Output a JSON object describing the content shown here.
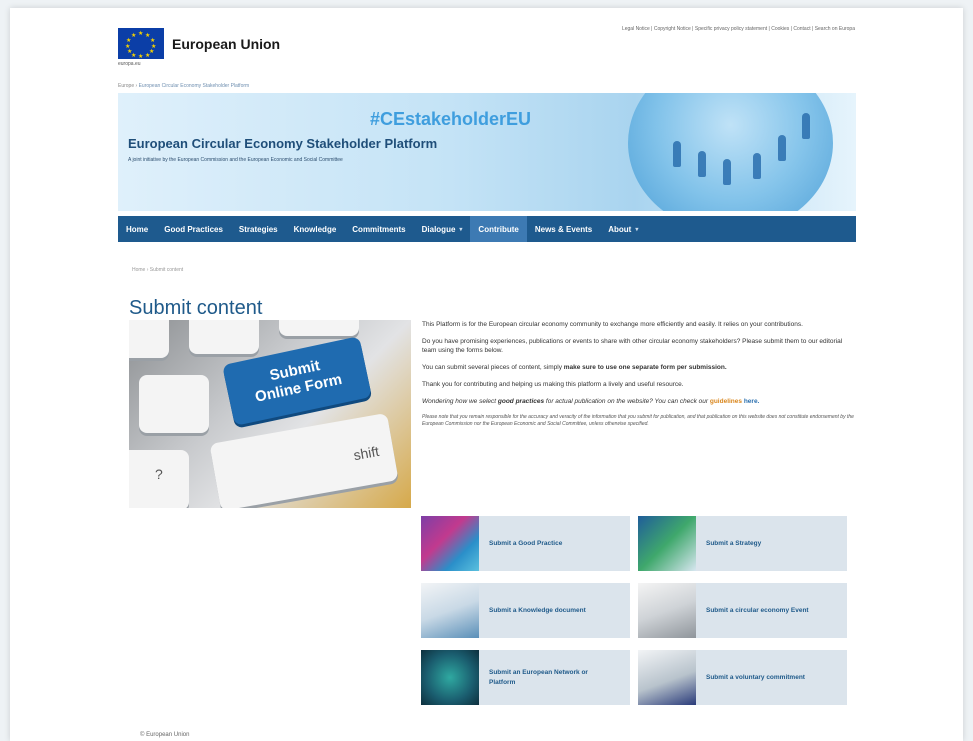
{
  "header": {
    "eu_title": "European Union",
    "eu_subtitle": "europa.eu",
    "top_links": [
      "Legal Notice",
      "Copyright Notice",
      "Specific privacy policy statement",
      "Cookies",
      "Contact",
      "Search on Europa"
    ],
    "top_links_separator": " | ",
    "breadcrumb_root": "Europe",
    "breadcrumb_current": "European Circular Economy Stakeholder Platform"
  },
  "banner": {
    "hashtag": "#CEstakeholderEU",
    "title": "European Circular Economy Stakeholder Platform",
    "subtitle": "A joint initiative by the European Commission and the European Economic and Social Committee"
  },
  "nav": {
    "items": [
      {
        "label": "Home",
        "dropdown": false,
        "active": false
      },
      {
        "label": "Good Practices",
        "dropdown": false,
        "active": false
      },
      {
        "label": "Strategies",
        "dropdown": false,
        "active": false
      },
      {
        "label": "Knowledge",
        "dropdown": false,
        "active": false
      },
      {
        "label": "Commitments",
        "dropdown": false,
        "active": false
      },
      {
        "label": "Dialogue",
        "dropdown": true,
        "active": false
      },
      {
        "label": "Contribute",
        "dropdown": false,
        "active": true
      },
      {
        "label": "News & Events",
        "dropdown": false,
        "active": false
      },
      {
        "label": "About",
        "dropdown": true,
        "active": false
      }
    ]
  },
  "breadcrumb": {
    "home": "Home",
    "current": "Submit content"
  },
  "page_title": "Submit content",
  "hero": {
    "key_label_line1": "Submit",
    "key_label_line2": "Online Form",
    "shift_label": "shift"
  },
  "intro": {
    "p1": "This Platform is for the European circular economy community to exchange more efficiently and easily. It relies on your contributions.",
    "p2": "Do you have promising experiences, publications or events to share with other circular economy stakeholders? Please submit them to our editorial team using the forms below.",
    "p3_start": "You can submit several pieces of content, simply ",
    "p3_bold": "make sure to use one separate form per submission.",
    "p4": "Thank you for contributing and helping us making this platform a lively and useful resource.",
    "p5_start": "Wondering how we select ",
    "p5_bold": "good practices",
    "p5_mid": " for actual publication on the website? You can check our ",
    "p5_link": "guidelines",
    "p5_here": "here.",
    "note": "Please note that you remain responsible for the accuracy and veracity of the information that you submit for publication, and that publication on this website does not constitute endorsement by the European Commission nor the European Economic and Social Committee, unless otherwise specified."
  },
  "tiles": [
    {
      "label": "Submit a Good Practice"
    },
    {
      "label": "Submit a Strategy"
    },
    {
      "label": "Submit a Knowledge document"
    },
    {
      "label": "Submit a circular economy Event"
    },
    {
      "label": "Submit an European Network or Platform"
    },
    {
      "label": "Submit a voluntary commitment"
    }
  ],
  "footer": {
    "copyright": "© European Union"
  },
  "colors": {
    "nav_bg": "#1e5a8e",
    "nav_active": "#3d7ab3",
    "title_blue": "#1f5a8a",
    "tile_bg": "#dbe4ec",
    "hashtag": "#3f9ede",
    "link_orange": "#d9861c"
  }
}
